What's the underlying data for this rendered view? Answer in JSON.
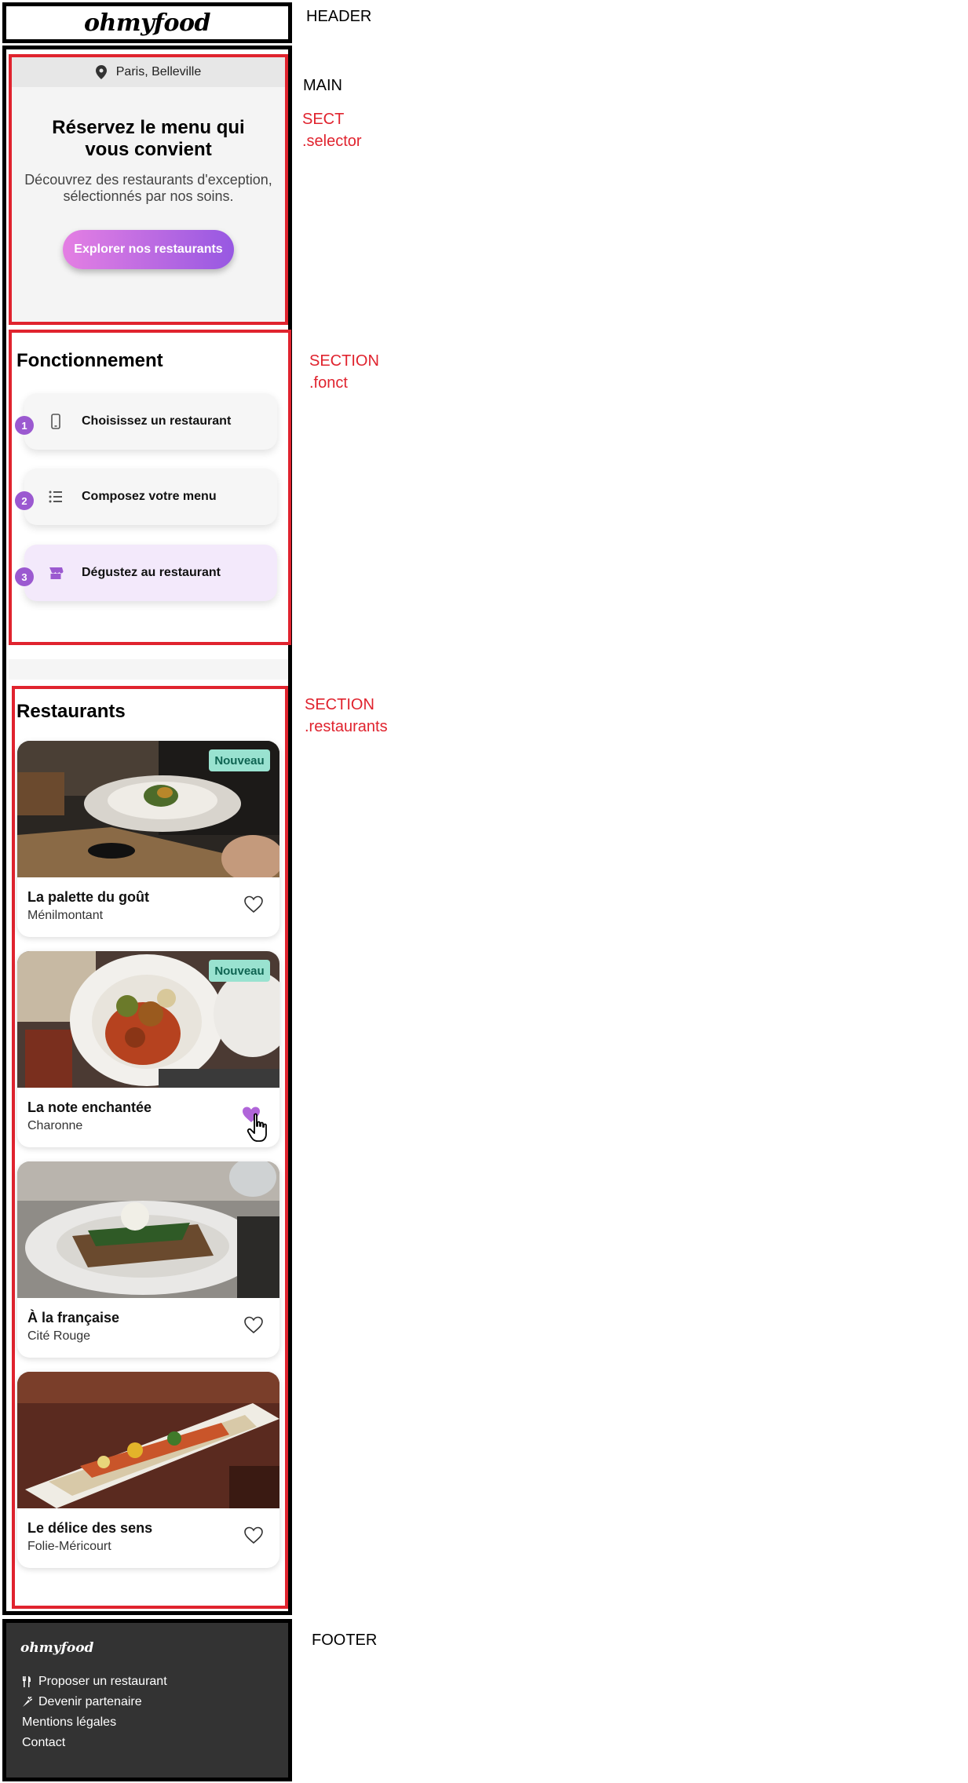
{
  "annotations": {
    "header": "HEADER",
    "main": "MAIN",
    "sect_line1": "SECT",
    "sect_line2": ".selector",
    "fonct_line1": "SECTION",
    "fonct_line2": ".fonct",
    "restos_line1": "SECTION",
    "restos_line2": ".restaurants",
    "footer": "FOOTER",
    "colors": {
      "label_red": "#e0232e",
      "frame_black": "#000000"
    }
  },
  "header": {
    "logo": "ohmyfood"
  },
  "selector": {
    "location": "Paris, Belleville",
    "location_icon": "map-pin-icon",
    "title": "Réservez le menu qui vous convient",
    "subtitle": "Découvrez des restaurants d'exception, sélectionnés par nos soins.",
    "cta": "Explorer nos restaurants"
  },
  "fonct": {
    "title": "Fonctionnement",
    "steps": [
      {
        "num": "1",
        "label": "Choisissez un restaurant",
        "icon": "mobile-phone-icon"
      },
      {
        "num": "2",
        "label": "Composez votre menu",
        "icon": "list-icon"
      },
      {
        "num": "3",
        "label": "Dégustez au restaurant",
        "icon": "store-icon"
      }
    ]
  },
  "restaurants": {
    "title": "Restaurants",
    "items": [
      {
        "name": "La palette du goût",
        "area": "Ménilmontant",
        "badge": "Nouveau",
        "liked": false
      },
      {
        "name": "La note enchantée",
        "area": "Charonne",
        "badge": "Nouveau",
        "liked": true
      },
      {
        "name": "À la française",
        "area": "Cité Rouge",
        "badge": "",
        "liked": false
      },
      {
        "name": "Le délice des sens",
        "area": "Folie-Méricourt",
        "badge": "",
        "liked": false
      }
    ]
  },
  "footer": {
    "logo": "ohmyfood",
    "links": [
      {
        "label": "Proposer un restaurant",
        "icon": "utensils-icon"
      },
      {
        "label": "Devenir partenaire",
        "icon": "carrot-icon"
      },
      {
        "label": "Mentions légales",
        "icon": ""
      },
      {
        "label": "Contact",
        "icon": ""
      }
    ]
  },
  "theme": {
    "accent_gradient_start": "#e47fe3",
    "accent_gradient_end": "#9758e2",
    "step_number_bg": "#9b59d0",
    "badge_bg": "#99e2d0",
    "heart_liked": "#b065d9",
    "footer_bg": "#333333"
  }
}
